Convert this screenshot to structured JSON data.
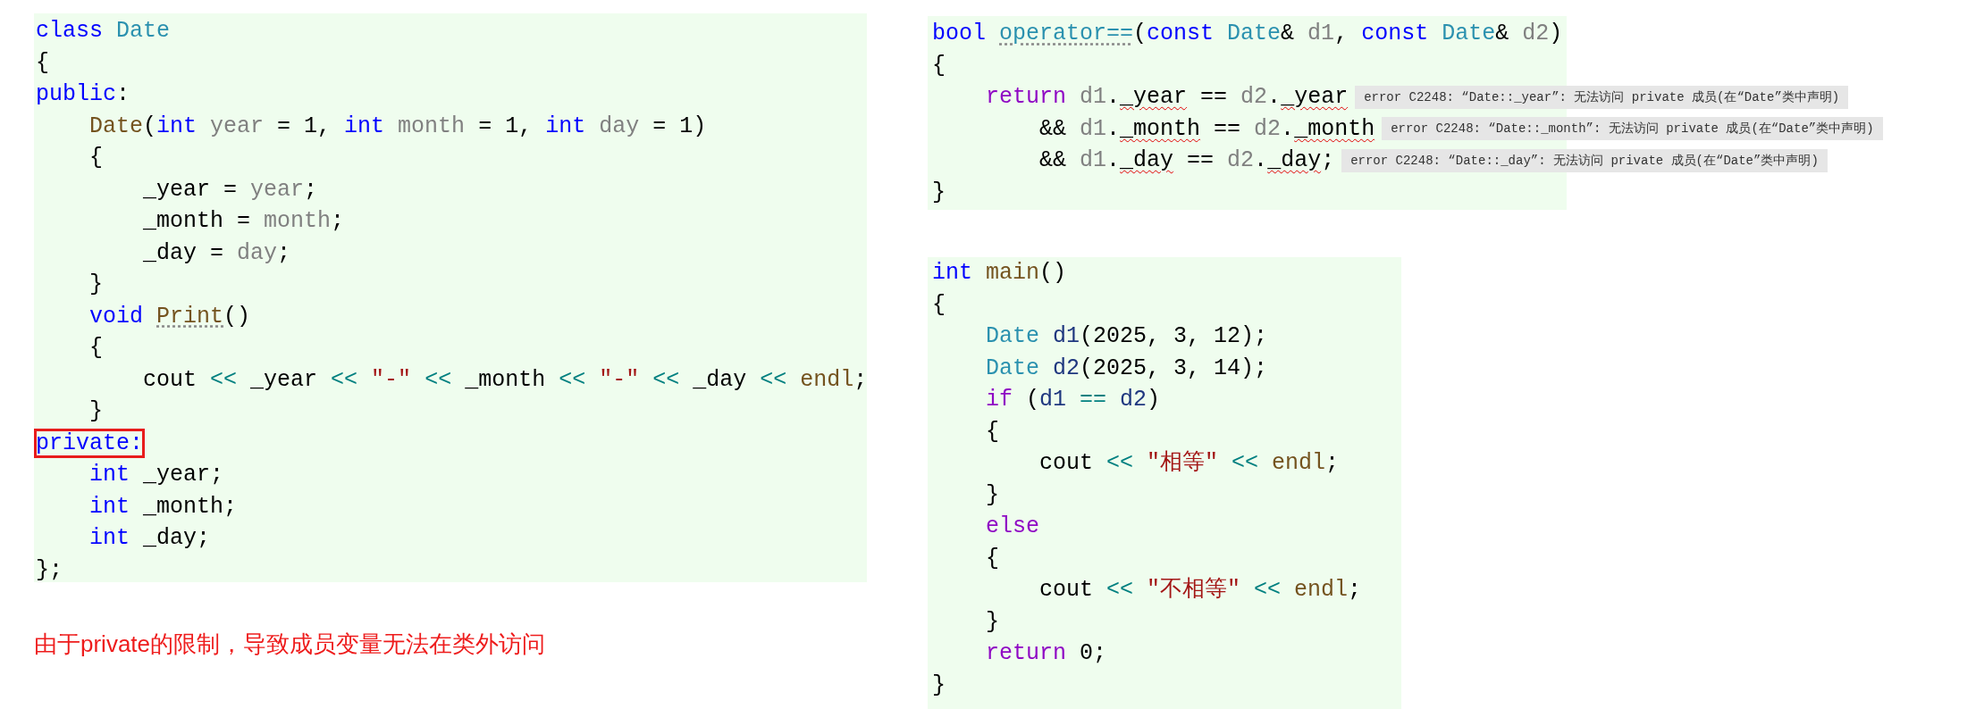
{
  "class_code": {
    "lines": [
      [
        {
          "kind": "keyword",
          "text": "class "
        },
        {
          "kind": "type",
          "text": "Date"
        }
      ],
      [
        {
          "kind": "plain",
          "text": "{"
        }
      ],
      [
        {
          "kind": "keyword",
          "text": "public"
        },
        {
          "kind": "plain",
          "text": ":"
        }
      ],
      [
        {
          "kind": "function",
          "text": "    Date"
        },
        {
          "kind": "plain",
          "text": "("
        },
        {
          "kind": "keyword",
          "text": "int "
        },
        {
          "kind": "param",
          "text": "year"
        },
        {
          "kind": "plain",
          "text": " = 1, "
        },
        {
          "kind": "keyword",
          "text": "int "
        },
        {
          "kind": "param",
          "text": "month"
        },
        {
          "kind": "plain",
          "text": " = 1, "
        },
        {
          "kind": "keyword",
          "text": "int "
        },
        {
          "kind": "param",
          "text": "day"
        },
        {
          "kind": "plain",
          "text": " = 1)"
        }
      ],
      [
        {
          "kind": "plain",
          "text": "    {"
        }
      ],
      [
        {
          "kind": "plain",
          "text": "        _year = "
        },
        {
          "kind": "param",
          "text": "year"
        },
        {
          "kind": "plain",
          "text": ";"
        }
      ],
      [
        {
          "kind": "plain",
          "text": "        _month = "
        },
        {
          "kind": "param",
          "text": "month"
        },
        {
          "kind": "plain",
          "text": ";"
        }
      ],
      [
        {
          "kind": "plain",
          "text": "        _day = "
        },
        {
          "kind": "param",
          "text": "day"
        },
        {
          "kind": "plain",
          "text": ";"
        }
      ],
      [
        {
          "kind": "plain",
          "text": "    }"
        }
      ],
      [
        {
          "kind": "keyword",
          "text": "    void "
        },
        {
          "kind": "hinted_function",
          "text": "Print"
        },
        {
          "kind": "plain",
          "text": "()"
        }
      ],
      [
        {
          "kind": "plain",
          "text": "    {"
        }
      ],
      [
        {
          "kind": "plain",
          "text": "        cout "
        },
        {
          "kind": "operator",
          "text": "<<"
        },
        {
          "kind": "plain",
          "text": " _year "
        },
        {
          "kind": "operator",
          "text": "<<"
        },
        {
          "kind": "string",
          "text": " \"-\" "
        },
        {
          "kind": "operator",
          "text": "<<"
        },
        {
          "kind": "plain",
          "text": " _month "
        },
        {
          "kind": "operator",
          "text": "<<"
        },
        {
          "kind": "string",
          "text": " \"-\" "
        },
        {
          "kind": "operator",
          "text": "<<"
        },
        {
          "kind": "plain",
          "text": " _day "
        },
        {
          "kind": "operator",
          "text": "<<"
        },
        {
          "kind": "function",
          "text": " endl"
        },
        {
          "kind": "plain",
          "text": ";"
        }
      ],
      [
        {
          "kind": "plain",
          "text": "    }"
        }
      ],
      [
        {
          "kind": "annotated_keyword",
          "text": "private:"
        }
      ],
      [
        {
          "kind": "keyword",
          "text": "    int "
        },
        {
          "kind": "plain",
          "text": "_year;"
        }
      ],
      [
        {
          "kind": "keyword",
          "text": "    int "
        },
        {
          "kind": "plain",
          "text": "_month;"
        }
      ],
      [
        {
          "kind": "keyword",
          "text": "    int "
        },
        {
          "kind": "plain",
          "text": "_day;"
        }
      ],
      [
        {
          "kind": "plain",
          "text": "};"
        }
      ]
    ]
  },
  "note": "由于private的限制，导致成员变量无法在类外访问",
  "operator_code": {
    "lines": [
      {
        "tokens": [
          {
            "kind": "keyword",
            "text": "bool "
          },
          {
            "kind": "hinted_type",
            "text": "operator=="
          },
          {
            "kind": "plain",
            "text": "("
          },
          {
            "kind": "keyword",
            "text": "const "
          },
          {
            "kind": "type",
            "text": "Date"
          },
          {
            "kind": "plain",
            "text": "& "
          },
          {
            "kind": "param",
            "text": "d1"
          },
          {
            "kind": "plain",
            "text": ", "
          },
          {
            "kind": "keyword",
            "text": "const "
          },
          {
            "kind": "type",
            "text": "Date"
          },
          {
            "kind": "plain",
            "text": "& "
          },
          {
            "kind": "param",
            "text": "d2"
          },
          {
            "kind": "plain",
            "text": ")"
          }
        ]
      },
      {
        "tokens": [
          {
            "kind": "plain",
            "text": "{"
          }
        ]
      },
      {
        "tokens": [
          {
            "kind": "control",
            "text": "    return "
          },
          {
            "kind": "param",
            "text": "d1"
          },
          {
            "kind": "plain",
            "text": "."
          },
          {
            "kind": "error_member",
            "text": "_year"
          },
          {
            "kind": "plain",
            "text": " == "
          },
          {
            "kind": "param",
            "text": "d2"
          },
          {
            "kind": "plain",
            "text": "."
          },
          {
            "kind": "error_member",
            "text": "_year"
          }
        ],
        "error": "error C2248: “Date::_year”: 无法访问 private 成员(在“Date”类中声明)"
      },
      {
        "tokens": [
          {
            "kind": "plain",
            "text": "        && "
          },
          {
            "kind": "param",
            "text": "d1"
          },
          {
            "kind": "plain",
            "text": "."
          },
          {
            "kind": "error_member",
            "text": "_month"
          },
          {
            "kind": "plain",
            "text": " == "
          },
          {
            "kind": "param",
            "text": "d2"
          },
          {
            "kind": "plain",
            "text": "."
          },
          {
            "kind": "error_member",
            "text": "_month"
          }
        ],
        "error": "error C2248: “Date::_month”: 无法访问 private 成员(在“Date”类中声明)"
      },
      {
        "tokens": [
          {
            "kind": "plain",
            "text": "        && "
          },
          {
            "kind": "param",
            "text": "d1"
          },
          {
            "kind": "plain",
            "text": "."
          },
          {
            "kind": "error_member",
            "text": "_day"
          },
          {
            "kind": "plain",
            "text": " == "
          },
          {
            "kind": "param",
            "text": "d2"
          },
          {
            "kind": "plain",
            "text": "."
          },
          {
            "kind": "error_member",
            "text": "_day"
          },
          {
            "kind": "plain",
            "text": ";"
          }
        ],
        "error": "error C2248: “Date::_day”: 无法访问 private 成员(在“Date”类中声明)"
      },
      {
        "tokens": [
          {
            "kind": "plain",
            "text": "}"
          }
        ]
      }
    ]
  },
  "main_code": {
    "lines": [
      [
        {
          "kind": "keyword",
          "text": "int "
        },
        {
          "kind": "function",
          "text": "main"
        },
        {
          "kind": "plain",
          "text": "()"
        }
      ],
      [
        {
          "kind": "plain",
          "text": "{"
        }
      ],
      [
        {
          "kind": "type",
          "text": "    Date "
        },
        {
          "kind": "local",
          "text": "d1"
        },
        {
          "kind": "plain",
          "text": "(2025, 3, 12);"
        }
      ],
      [
        {
          "kind": "type",
          "text": "    Date "
        },
        {
          "kind": "local",
          "text": "d2"
        },
        {
          "kind": "plain",
          "text": "(2025, 3, 14);"
        }
      ],
      [
        {
          "kind": "control",
          "text": "    if "
        },
        {
          "kind": "plain",
          "text": "("
        },
        {
          "kind": "local",
          "text": "d1 "
        },
        {
          "kind": "operator",
          "text": "=="
        },
        {
          "kind": "local",
          "text": " d2"
        },
        {
          "kind": "plain",
          "text": ")"
        }
      ],
      [
        {
          "kind": "plain",
          "text": "    {"
        }
      ],
      [
        {
          "kind": "plain",
          "text": "        cout "
        },
        {
          "kind": "operator",
          "text": "<<"
        },
        {
          "kind": "string",
          "text": " \"相等\" "
        },
        {
          "kind": "operator",
          "text": "<<"
        },
        {
          "kind": "function",
          "text": " endl"
        },
        {
          "kind": "plain",
          "text": ";"
        }
      ],
      [
        {
          "kind": "plain",
          "text": "    }"
        }
      ],
      [
        {
          "kind": "control",
          "text": "    else"
        }
      ],
      [
        {
          "kind": "plain",
          "text": "    {"
        }
      ],
      [
        {
          "kind": "plain",
          "text": "        cout "
        },
        {
          "kind": "operator",
          "text": "<<"
        },
        {
          "kind": "string",
          "text": " \"不相等\" "
        },
        {
          "kind": "operator",
          "text": "<<"
        },
        {
          "kind": "function",
          "text": " endl"
        },
        {
          "kind": "plain",
          "text": ";"
        }
      ],
      [
        {
          "kind": "plain",
          "text": "    }"
        }
      ],
      [
        {
          "kind": "control",
          "text": "    return "
        },
        {
          "kind": "plain",
          "text": "0;"
        }
      ],
      [
        {
          "kind": "plain",
          "text": "}"
        }
      ]
    ]
  }
}
